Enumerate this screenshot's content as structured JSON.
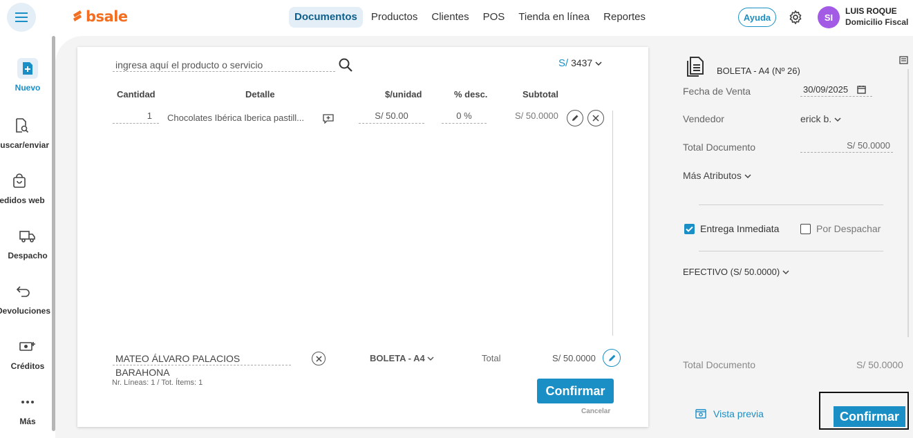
{
  "brand": {
    "name": "bsale",
    "color": "#f26f21"
  },
  "accent": "#1a8fc6",
  "nav": [
    {
      "label": "Documentos",
      "active": true
    },
    {
      "label": "Productos"
    },
    {
      "label": "Clientes"
    },
    {
      "label": "POS"
    },
    {
      "label": "Tienda en línea"
    },
    {
      "label": "Reportes"
    }
  ],
  "header": {
    "help_label": "Ayuda",
    "avatar_initials": "SI",
    "user_name": "LUIS ROQUE",
    "user_role": "Domicilio Fiscal"
  },
  "sidebar": [
    {
      "label": "Nuevo",
      "icon": "new-document-icon",
      "active": true
    },
    {
      "label": "buscar/enviar",
      "icon": "search-document-icon"
    },
    {
      "label": "Pedidos web",
      "icon": "shopping-bag-icon"
    },
    {
      "label": "Despacho",
      "icon": "truck-icon"
    },
    {
      "label": "Devoluciones",
      "icon": "return-arrow-icon"
    },
    {
      "label": "Créditos",
      "icon": "money-add-icon"
    },
    {
      "label": "Más",
      "icon": "more-dots-icon"
    }
  ],
  "editor": {
    "search_placeholder": "ingresa aquí el producto o servicio",
    "currency_symbol": "S/",
    "currency_code": "3437",
    "columns": {
      "qty": "Cantidad",
      "detail": "Detalle",
      "unit": "$/unidad",
      "discount": "% desc.",
      "subtotal": "Subtotal"
    },
    "rows": [
      {
        "qty": "1",
        "detail": "Chocolates Ibérica Iberica pastill...",
        "unit": "S/ 50.00",
        "discount": "0 %",
        "subtotal": "S/ 50.0000"
      }
    ],
    "client": "MATEO ÁLVARO PALACIOS BARAHONA",
    "doc_type": "BOLETA - A4",
    "total_label": "Total",
    "total_value": "S/ 50.0000",
    "lines_info": "Nr. Líneas: 1 / Tot. Ítems: 1",
    "confirm_label": "Confirmar",
    "cancel_label": "Cancelar"
  },
  "panel": {
    "title": "BOLETA - A4 (Nº 26)",
    "sale_date_label": "Fecha de Venta",
    "sale_date": "30/09/2025",
    "seller_label": "Vendedor",
    "seller": "erick b.",
    "doc_total_label": "Total Documento",
    "doc_total": "S/ 50.0000",
    "more_attrs": "Más Atributos",
    "immediate_label": "Entrega Inmediata",
    "immediate_checked": true,
    "dispatch_label": "Por Despachar",
    "dispatch_checked": false,
    "payment": "EFECTIVO (S/ 50.0000)",
    "footer_total_label": "Total Documento",
    "footer_total": "S/ 50.0000",
    "preview_label": "Vista previa",
    "confirm_label": "Confirmar"
  }
}
